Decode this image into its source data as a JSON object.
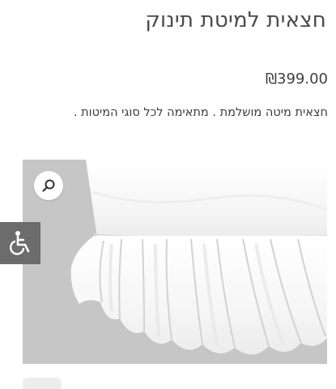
{
  "product": {
    "title": "חצאית למיטת תינוק",
    "price": "₪399.00",
    "description": "חצאית מיטה מושלמת . מתאימה לכל סוגי המיטות ."
  },
  "gallery": {
    "zoom_icon": "magnifier-icon",
    "image_subject": "white ruffled crib skirt"
  },
  "accessibility": {
    "icon": "wheelchair-icon"
  },
  "colors": {
    "background": "#ffffff",
    "text": "#3a3a3a",
    "image_backdrop": "#c6c6c6",
    "accessibility_button": "#6c6c6c"
  }
}
